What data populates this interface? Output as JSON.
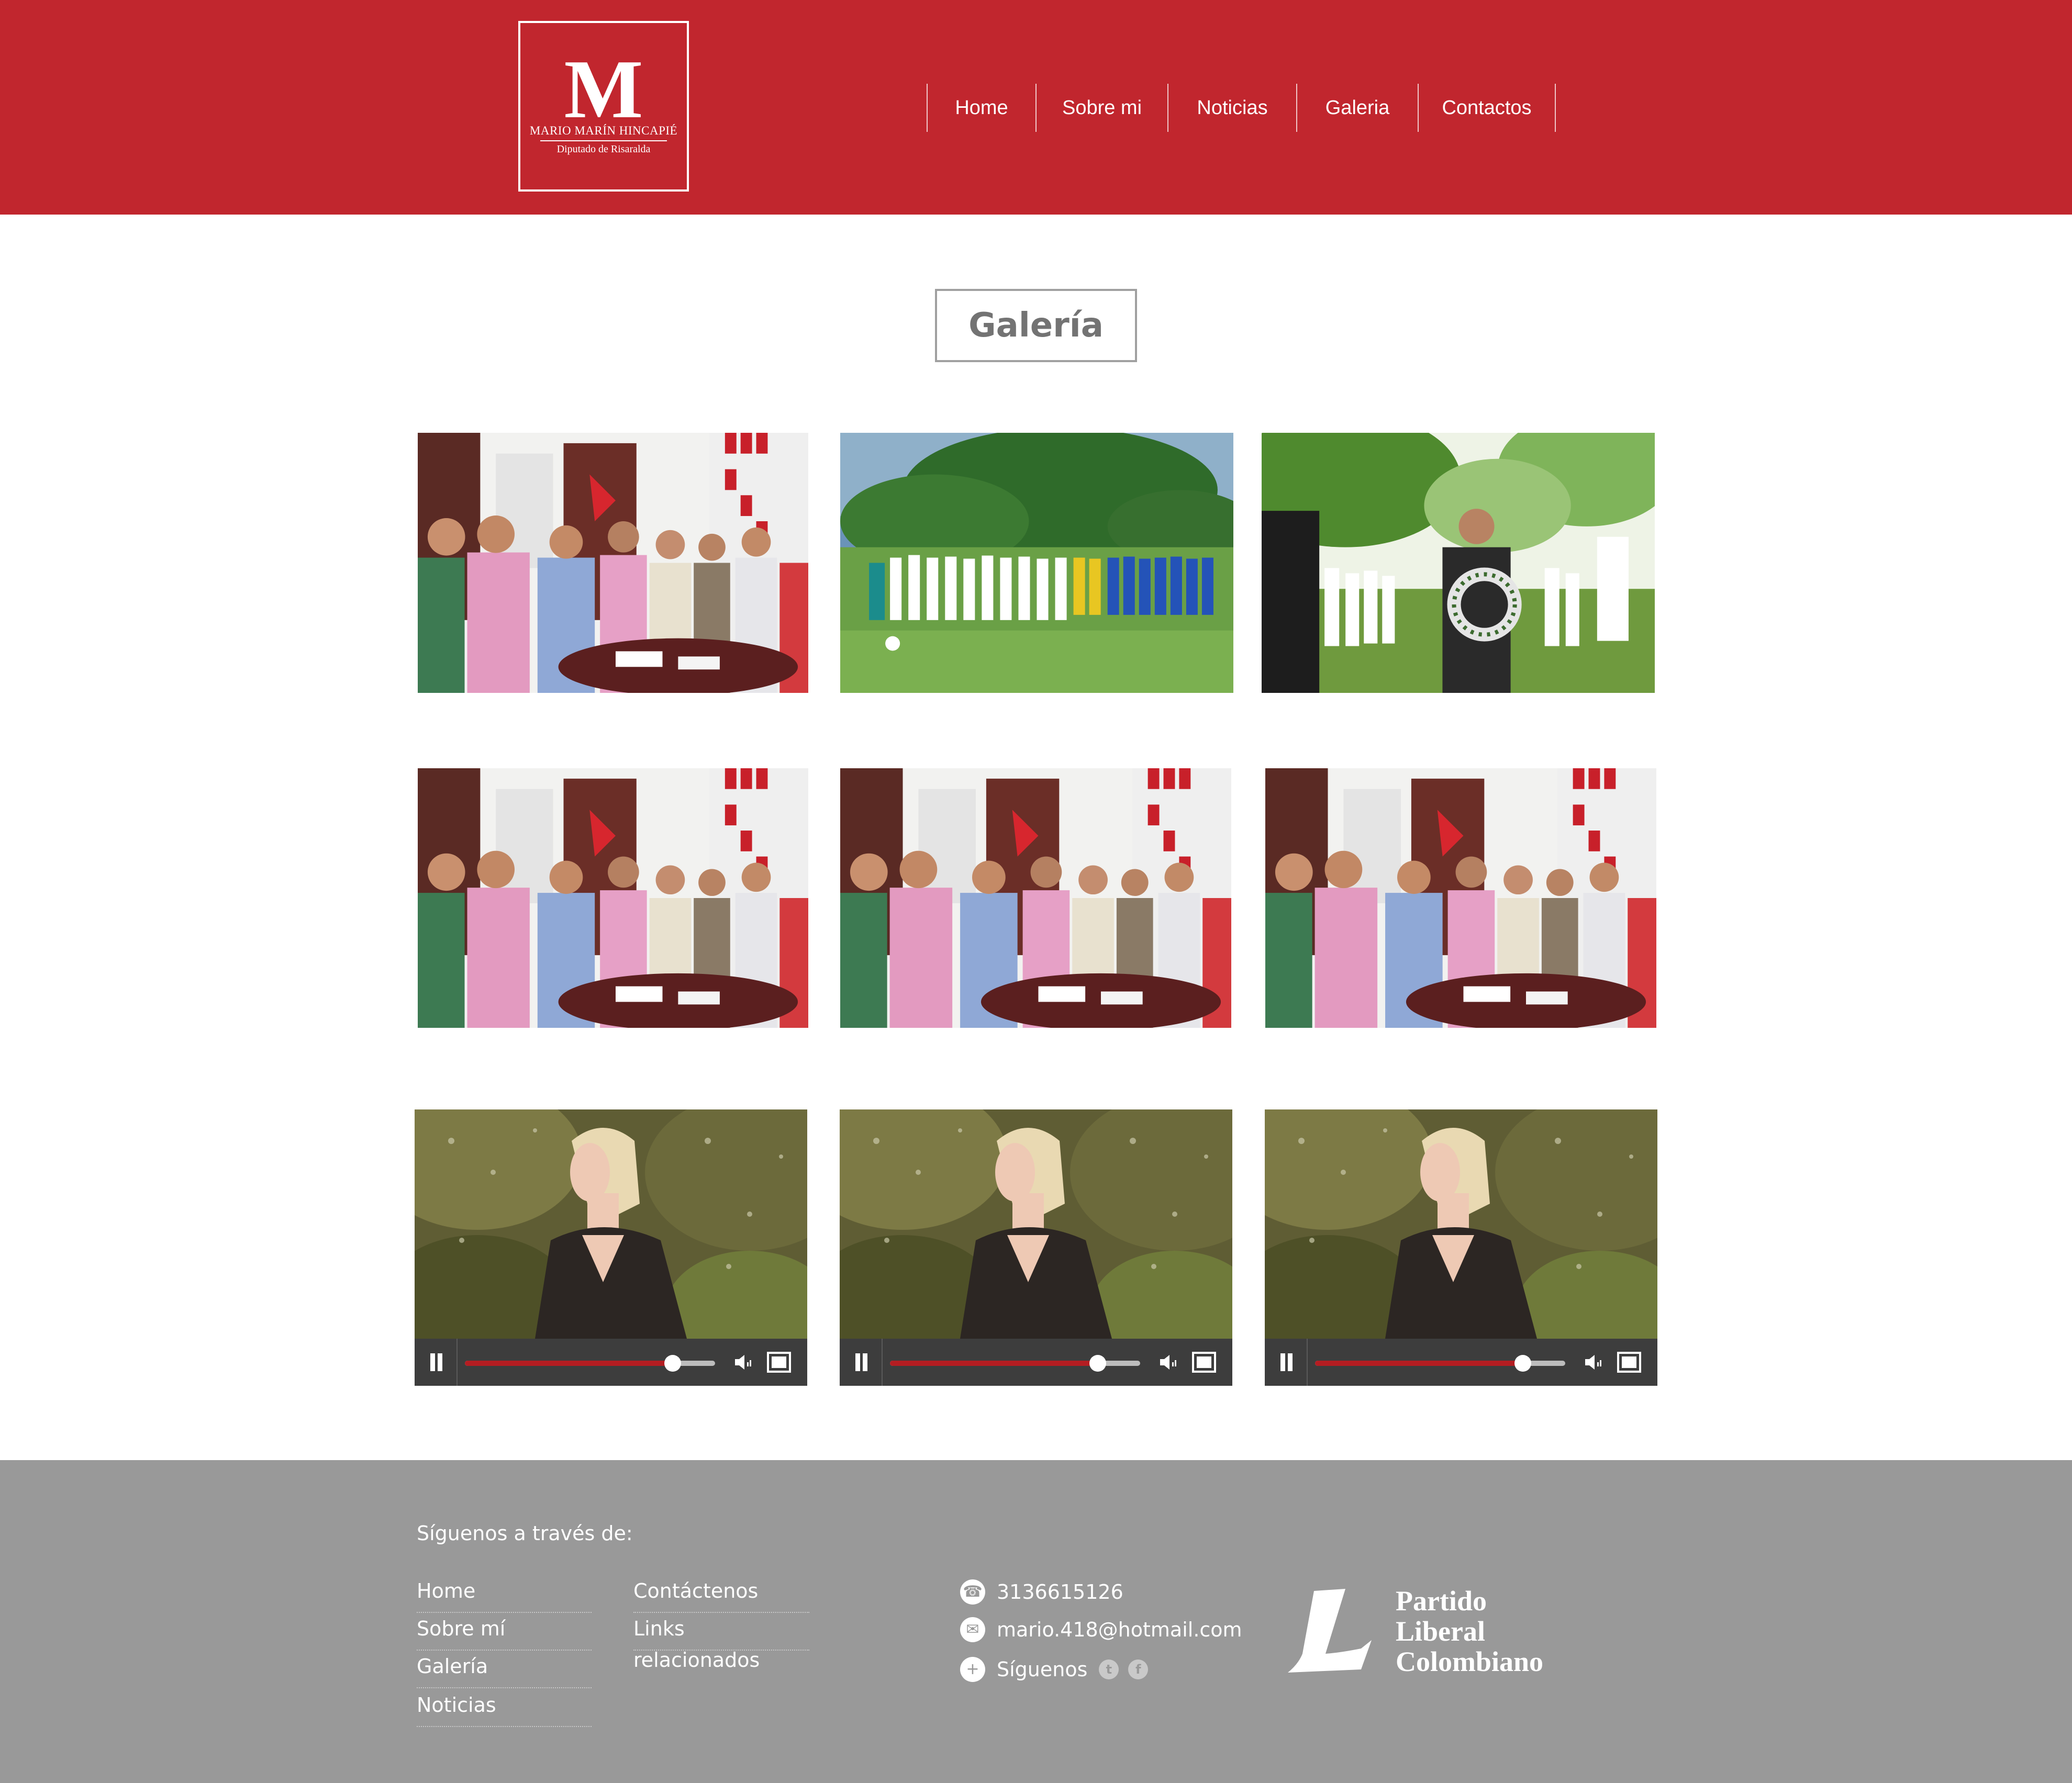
{
  "colors": {
    "brand_red": "#c1262e",
    "footer_gray": "#999999",
    "progress_red": "#b41d22"
  },
  "header": {
    "logo": {
      "letter": "M",
      "name": "MARIO MARÍN HINCAPIÉ",
      "subtitle": "Diputado de Risaralda"
    },
    "nav": [
      "Home",
      "Sobre mi",
      "Noticias",
      "Galeria",
      "Contactos"
    ]
  },
  "main": {
    "title": "Galería",
    "videos": [
      {
        "progress": 0.83,
        "state": "playing"
      },
      {
        "progress": 0.83,
        "state": "playing"
      },
      {
        "progress": 0.83,
        "state": "playing"
      }
    ]
  },
  "footer": {
    "follow_title": "Síguenos a través de:",
    "links_col1": [
      "Home",
      "Sobre mí",
      "Galería",
      "Noticias"
    ],
    "links_col2": [
      "Contáctenos",
      "Links relacionados"
    ],
    "phone": "3136615126",
    "email": "mario.418@hotmail.com",
    "follow_label": "Síguenos",
    "social_icons": [
      "twitter-icon",
      "facebook-icon"
    ],
    "partner": {
      "line1": "Partido",
      "line2": "Liberal",
      "line3": "Colombiano"
    }
  }
}
